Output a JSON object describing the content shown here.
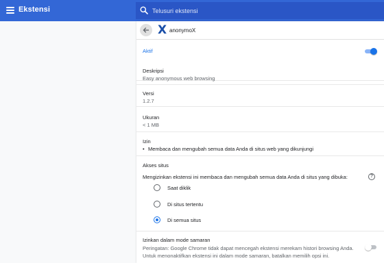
{
  "app": {
    "title": "Ekstensi"
  },
  "search": {
    "placeholder": "Telusuri ekstensi",
    "value": ""
  },
  "extension": {
    "name": "anonymoX",
    "logo_glyph": "X",
    "enabled": true,
    "enabled_label": "Aktif",
    "description_label": "Deskripsi",
    "description": "Easy anonymous web browsing",
    "version_label": "Versi",
    "version": "1.2.7",
    "size_label": "Ukuran",
    "size": "< 1 MB",
    "permissions_label": "Izin",
    "permissions": [
      "Membaca dan mengubah semua data Anda di situs web yang dikunjungi"
    ]
  },
  "site_access": {
    "label": "Akses situs",
    "prompt": "Mengizinkan ekstensi ini membaca dan mengubah semua data Anda di situs yang dibuka:",
    "options": [
      {
        "label": "Saat diklik",
        "selected": false
      },
      {
        "label": "Di situs tertentu",
        "selected": false
      },
      {
        "label": "Di semua situs",
        "selected": true
      }
    ]
  },
  "incognito": {
    "label": "Izinkan dalam mode samaran",
    "enabled": false,
    "warning": "Peringatan: Google Chrome tidak dapat mencegah ekstensi merekam histori browsing Anda. Untuk menonaktifkan ekstensi ini dalam mode samaran, batalkan memilih opsi ini."
  },
  "icons": {
    "menu": "hamburger-menu-icon",
    "search": "search-icon",
    "back": "arrow-left-icon",
    "help": "help-circle-icon"
  },
  "colors": {
    "header": "#3367d6",
    "search_bg": "#2a56c6",
    "accent": "#1a73e8",
    "logo": "#1a4fa8"
  }
}
